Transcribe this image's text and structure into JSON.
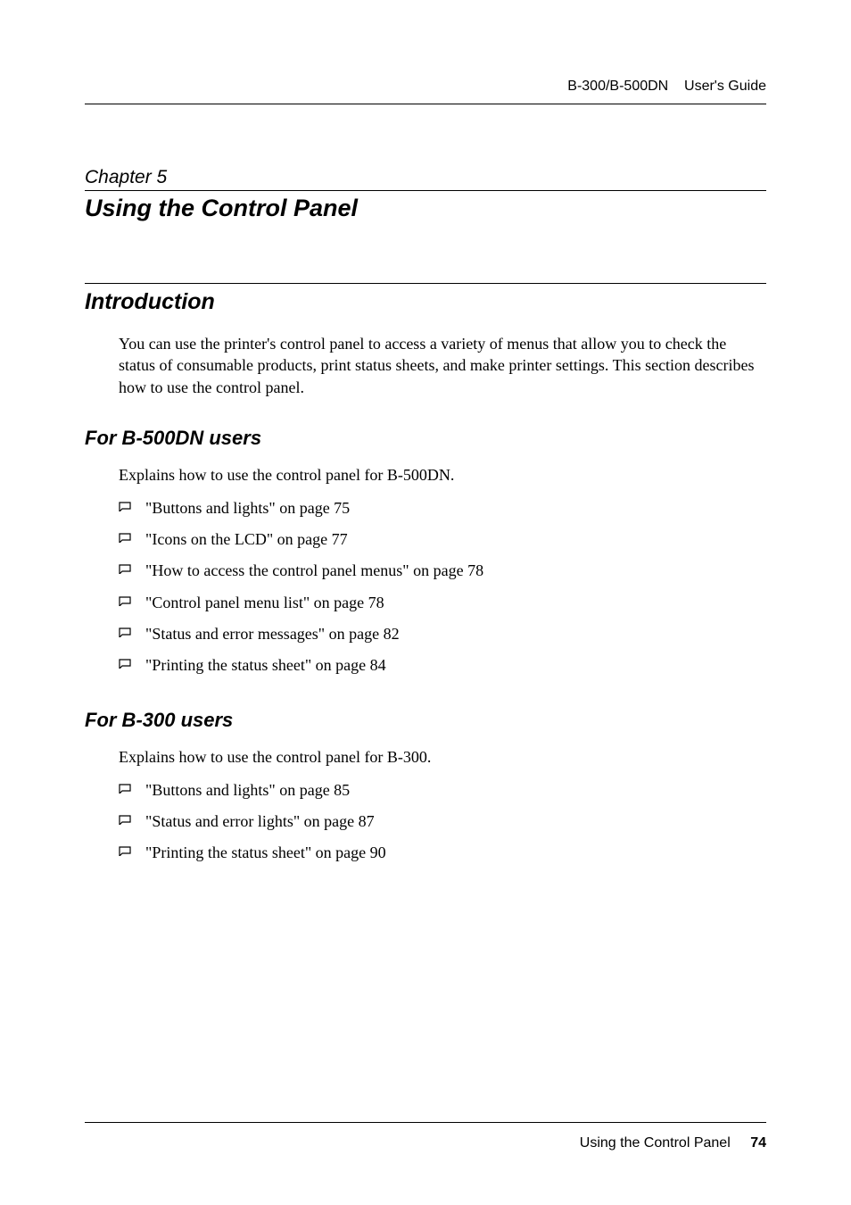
{
  "header": {
    "product": "B-300/B-500DN",
    "doc": "User's Guide"
  },
  "chapter": {
    "label": "Chapter 5",
    "title": "Using the Control Panel"
  },
  "sections": {
    "intro": {
      "heading": "Introduction",
      "body": "You can use the printer's control panel to access a variety of menus that allow you to check the status of consumable products, print status sheets, and make printer settings. This section describes how to use the control panel."
    },
    "b500": {
      "heading": "For B-500DN users",
      "intro": "Explains how to use the control panel for B-500DN.",
      "items": [
        "\"Buttons and lights\" on page 75",
        "\"Icons on the LCD\" on page 77",
        "\"How to access the control panel menus\" on page 78",
        "\"Control panel menu list\" on page 78",
        "\"Status and error messages\" on page 82",
        "\"Printing the status sheet\" on page 84"
      ]
    },
    "b300": {
      "heading": "For B-300 users",
      "intro": "Explains how to use the control panel for B-300.",
      "items": [
        "\"Buttons and lights\" on page 85",
        "\"Status and error lights\" on page 87",
        "\"Printing the status sheet\" on page 90"
      ]
    }
  },
  "footer": {
    "section": "Using the Control Panel",
    "page": "74"
  }
}
